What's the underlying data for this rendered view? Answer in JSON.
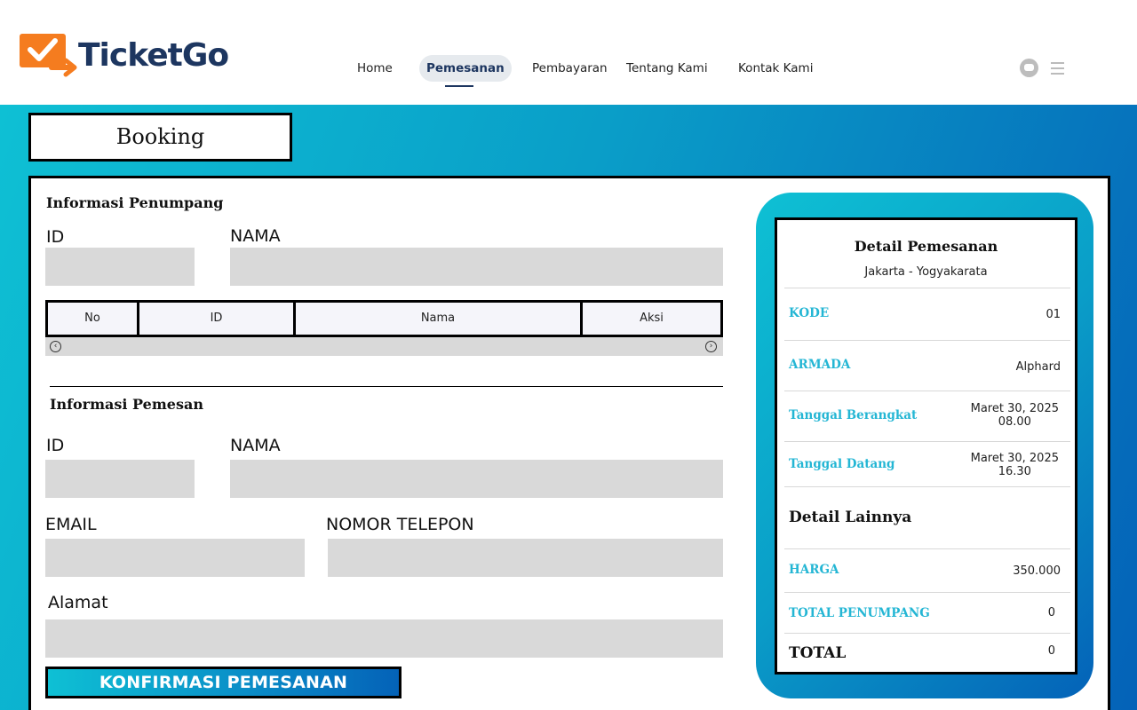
{
  "header": {
    "logo_text": "TicketGo",
    "nav": [
      {
        "label": "Home"
      },
      {
        "label": "Pemesanan"
      },
      {
        "label": "Pembayaran"
      },
      {
        "label": "Tentang Kami"
      },
      {
        "label": "Kontak Kami"
      }
    ],
    "icons": [
      "chat-icon",
      "hamburger-menu-icon"
    ],
    "colors": {
      "brand_navy": "#1d3660",
      "brand_orange": "#f57c1f"
    }
  },
  "page": {
    "title": "Booking"
  },
  "passenger": {
    "section_title": "Informasi Penumpang",
    "id_label": "ID",
    "name_label": "NAMA",
    "table_headers": [
      "No",
      "ID",
      "Nama",
      "Aksi"
    ],
    "scroll_left": "‹",
    "scroll_right": "›"
  },
  "booker": {
    "section_title": "Informasi Pemesan",
    "id_label": "ID",
    "name_label": "NAMA",
    "email_label": "EMAIL",
    "phone_label": "NOMOR TELEPON",
    "address_label": "Alamat",
    "confirm_label": "KONFIRMASI PEMESANAN"
  },
  "summary": {
    "title": "Detail Pemesanan",
    "route": "Jakarta - Yogyakarata",
    "kode_label": "KODE",
    "kode_value": "01",
    "armada_label": "ARMADA",
    "armada_value": "Alphard",
    "berangkat_label": "Tanggal Berangkat",
    "berangkat_date": "Maret 30, 2025",
    "berangkat_time": "08.00",
    "datang_label": "Tanggal Datang",
    "datang_date": "Maret 30, 2025",
    "datang_time": "16.30",
    "other_title": "Detail Lainnya",
    "harga_label": "HARGA",
    "harga_value": "350.000",
    "total_penumpang_label": "TOTAL PENUMPANG",
    "total_penumpang_value": "0",
    "total_label": "TOTAL",
    "total_value": "0"
  },
  "colors": {
    "accent_cyan": "#24b6d4",
    "gradient_start": "#0ec0d4",
    "gradient_end": "#0462b8",
    "field_gray": "#d9d9d9"
  }
}
